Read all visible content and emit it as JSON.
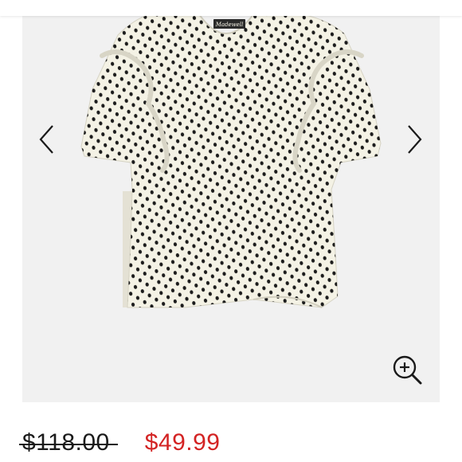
{
  "listing": {
    "brand_label": "Madewell",
    "price_original": "$118.00",
    "price_sale": "$49.99"
  },
  "colors": {
    "gallery_background": "#f1f1f1",
    "sale_price": "#d32323",
    "blouse_fabric": "#f4f2e5",
    "polka_dot": "#1c1c1c"
  },
  "icons": {
    "previous": "chevron-left-icon",
    "next": "chevron-right-icon",
    "zoom": "zoom-in-icon"
  }
}
